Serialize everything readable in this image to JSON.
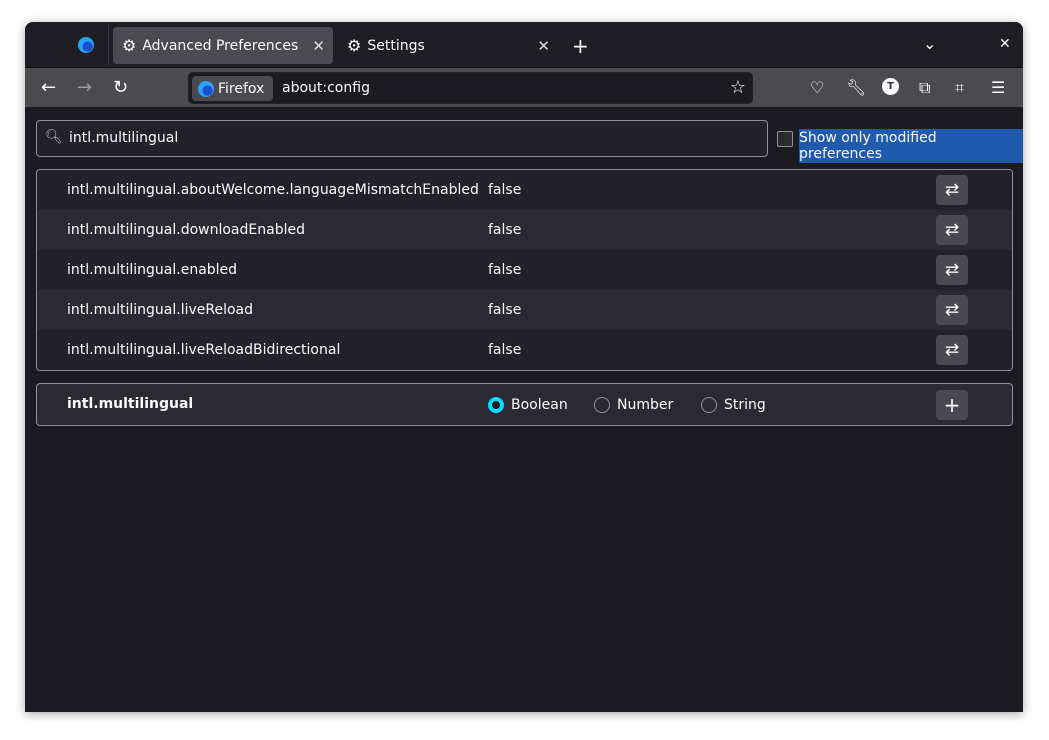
{
  "tabs": [
    {
      "label": "Advanced Preferences",
      "active": true
    },
    {
      "label": "Settings",
      "active": false
    }
  ],
  "toolbar": {
    "identity_label": "Firefox",
    "url": "about:config",
    "avatar_letter": "T"
  },
  "search": {
    "value": "intl.multilingual"
  },
  "filter": {
    "label": "Show only modified preferences",
    "checked": false
  },
  "prefs": [
    {
      "name": "intl.multilingual.aboutWelcome.languageMismatchEnabled",
      "value": "false"
    },
    {
      "name": "intl.multilingual.downloadEnabled",
      "value": "false"
    },
    {
      "name": "intl.multilingual.enabled",
      "value": "false"
    },
    {
      "name": "intl.multilingual.liveReload",
      "value": "false"
    },
    {
      "name": "intl.multilingual.liveReloadBidirectional",
      "value": "false"
    }
  ],
  "add": {
    "name": "intl.multilingual",
    "types": [
      "Boolean",
      "Number",
      "String"
    ],
    "selected": "Boolean"
  },
  "colors": {
    "accent": "#00ddff",
    "selection": "#1f5aad"
  }
}
